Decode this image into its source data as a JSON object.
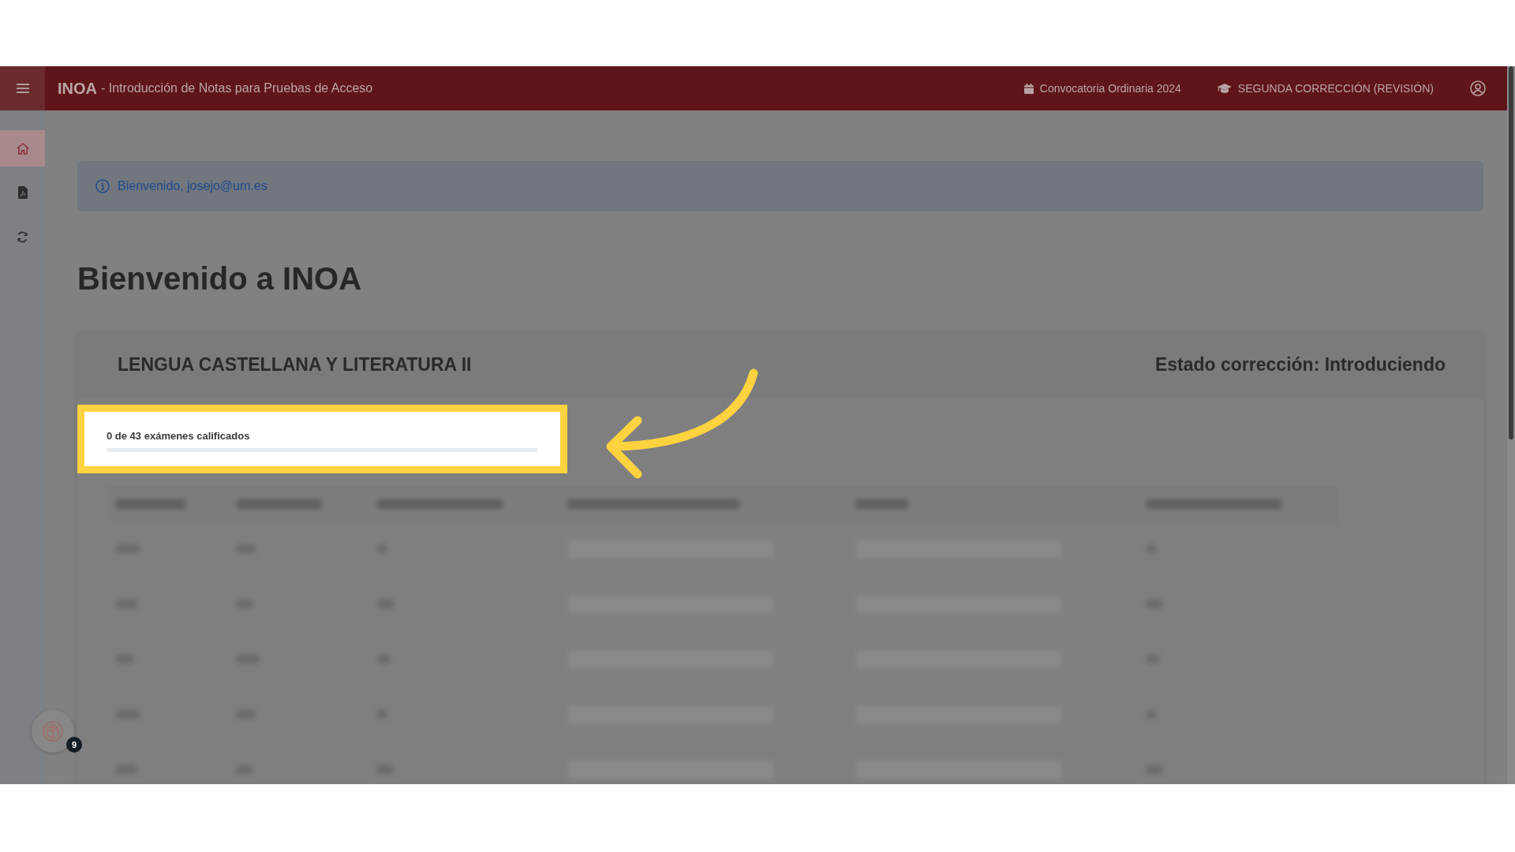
{
  "header": {
    "title": "INOA",
    "subtitle": "- Introducción de Notas para Pruebas de Acceso",
    "items": [
      {
        "kind": "calendar",
        "text": "Convocatoria Ordinaria 2024"
      },
      {
        "kind": "graduation",
        "text": "SEGUNDA CORRECCIÓN (REVISIÓN)"
      }
    ]
  },
  "sidebar": {
    "items": [
      {
        "kind": "home",
        "selected": true
      },
      {
        "kind": "pdf",
        "selected": false
      },
      {
        "kind": "refresh",
        "selected": false
      }
    ]
  },
  "alert": {
    "text": "Bienvenido, josejo@um.es"
  },
  "heading": "Bienvenido a INOA",
  "card": {
    "title": "LENGUA CASTELLANA Y LITERATURA II",
    "status": "Estado corrección: Introduciendo",
    "progress": {
      "label": "0 de 43 exámenes calificados",
      "level": 0
    }
  },
  "floating_button": {
    "badge": "9"
  }
}
